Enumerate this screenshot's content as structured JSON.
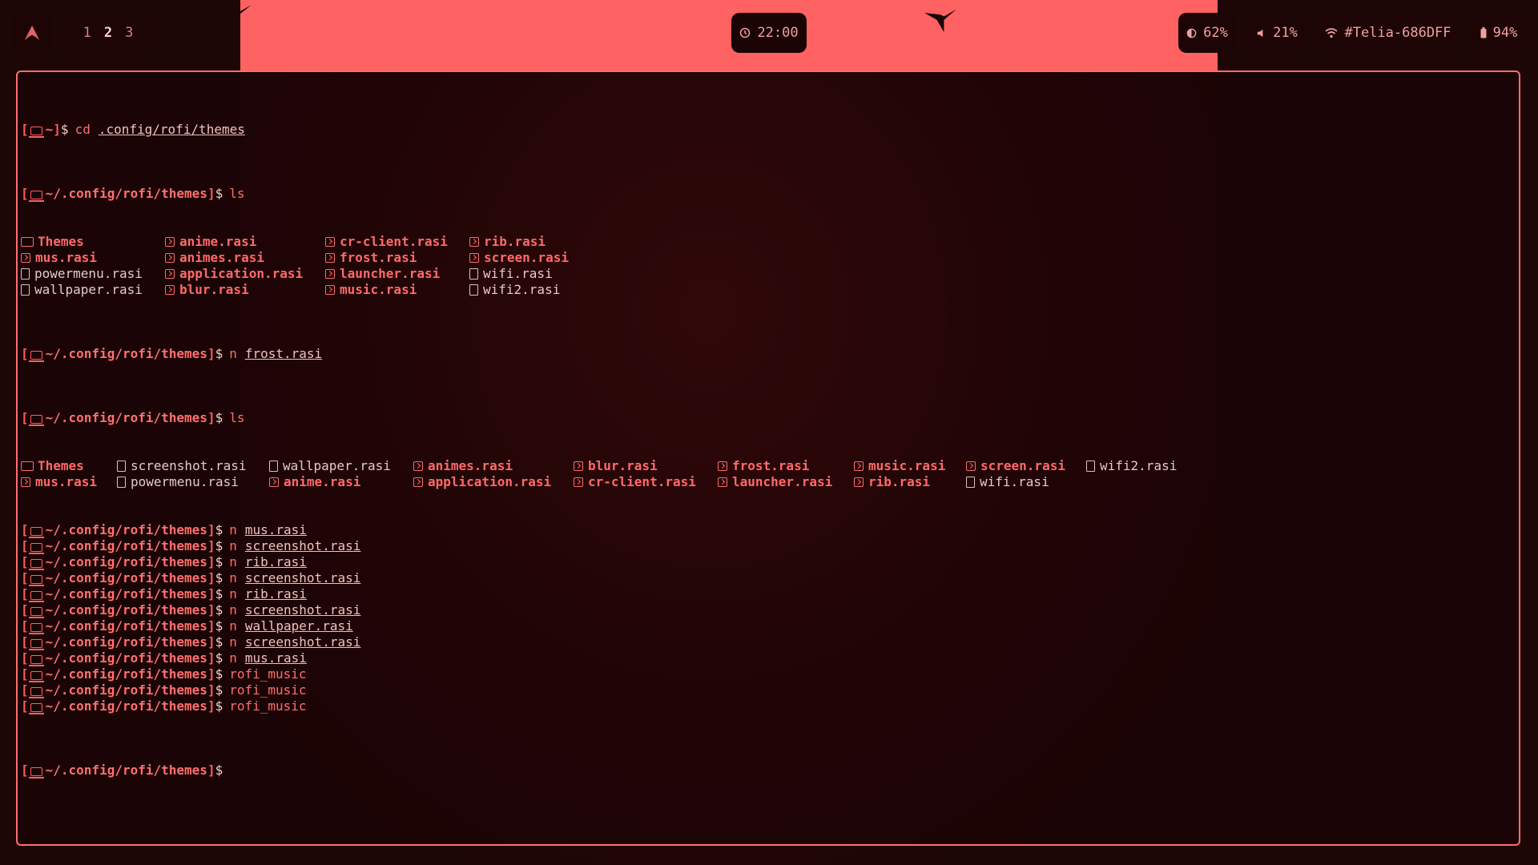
{
  "bar": {
    "launcher_icon": "arch-logo-icon",
    "workspaces": [
      "1",
      "2",
      "3"
    ],
    "active_workspace": "2",
    "clock": "22:00",
    "brightness": "62%",
    "volume": "21%",
    "wifi": "#Telia-686DFF",
    "battery": "94%"
  },
  "colors": {
    "accent": "#ff6262",
    "background": "#1c0606",
    "text": "#e6c9c9"
  },
  "terminal": {
    "home_prompt": "~",
    "themes_prompt": "~/.config/rofi/themes",
    "first_command": {
      "cmd": "cd",
      "arg": ".config/rofi/themes"
    },
    "ls1": {
      "cmd": "ls",
      "rows": [
        [
          {
            "name": "Themes",
            "kind": "dir"
          },
          {
            "name": "anime.rasi",
            "kind": "rasi"
          },
          {
            "name": "cr-client.rasi",
            "kind": "rasi"
          },
          {
            "name": "rib.rasi",
            "kind": "rasi"
          }
        ],
        [
          {
            "name": "mus.rasi",
            "kind": "rasi"
          },
          {
            "name": "animes.rasi",
            "kind": "rasi"
          },
          {
            "name": "frost.rasi",
            "kind": "rasi"
          },
          {
            "name": "screen.rasi",
            "kind": "rasi"
          }
        ],
        [
          {
            "name": "powermenu.rasi",
            "kind": "plain"
          },
          {
            "name": "application.rasi",
            "kind": "rasi"
          },
          {
            "name": "launcher.rasi",
            "kind": "rasi"
          },
          {
            "name": "wifi.rasi",
            "kind": "plain"
          }
        ],
        [
          {
            "name": "wallpaper.rasi",
            "kind": "plain"
          },
          {
            "name": "blur.rasi",
            "kind": "rasi"
          },
          {
            "name": "music.rasi",
            "kind": "rasi"
          },
          {
            "name": "wifi2.rasi",
            "kind": "plain"
          }
        ]
      ]
    },
    "cmd_after_ls1": {
      "cmd": "n",
      "arg": "frost.rasi"
    },
    "ls2": {
      "cmd": "ls",
      "rows": [
        [
          {
            "name": "Themes",
            "kind": "dir"
          },
          {
            "name": "screenshot.rasi",
            "kind": "plain"
          },
          {
            "name": "wallpaper.rasi",
            "kind": "plain"
          },
          {
            "name": "animes.rasi",
            "kind": "rasi"
          },
          {
            "name": "blur.rasi",
            "kind": "rasi"
          },
          {
            "name": "frost.rasi",
            "kind": "rasi"
          },
          {
            "name": "music.rasi",
            "kind": "rasi"
          },
          {
            "name": "screen.rasi",
            "kind": "rasi"
          },
          {
            "name": "wifi2.rasi",
            "kind": "plain"
          }
        ],
        [
          {
            "name": "mus.rasi",
            "kind": "rasi"
          },
          {
            "name": "powermenu.rasi",
            "kind": "plain"
          },
          {
            "name": "anime.rasi",
            "kind": "rasi"
          },
          {
            "name": "application.rasi",
            "kind": "rasi"
          },
          {
            "name": "cr-client.rasi",
            "kind": "rasi"
          },
          {
            "name": "launcher.rasi",
            "kind": "rasi"
          },
          {
            "name": "rib.rasi",
            "kind": "rasi"
          },
          {
            "name": "wifi.rasi",
            "kind": "plain"
          }
        ]
      ]
    },
    "history": [
      {
        "cmd": "n",
        "arg": "mus.rasi"
      },
      {
        "cmd": "n",
        "arg": "screenshot.rasi"
      },
      {
        "cmd": "n",
        "arg": "rib.rasi"
      },
      {
        "cmd": "n",
        "arg": "screenshot.rasi"
      },
      {
        "cmd": "n",
        "arg": "rib.rasi"
      },
      {
        "cmd": "n",
        "arg": "screenshot.rasi"
      },
      {
        "cmd": "n",
        "arg": "wallpaper.rasi"
      },
      {
        "cmd": "n",
        "arg": "screenshot.rasi"
      },
      {
        "cmd": "n",
        "arg": "mus.rasi"
      },
      {
        "cmd": "rofi_music",
        "arg": ""
      },
      {
        "cmd": "rofi_music",
        "arg": ""
      },
      {
        "cmd": "rofi_music",
        "arg": ""
      }
    ]
  }
}
